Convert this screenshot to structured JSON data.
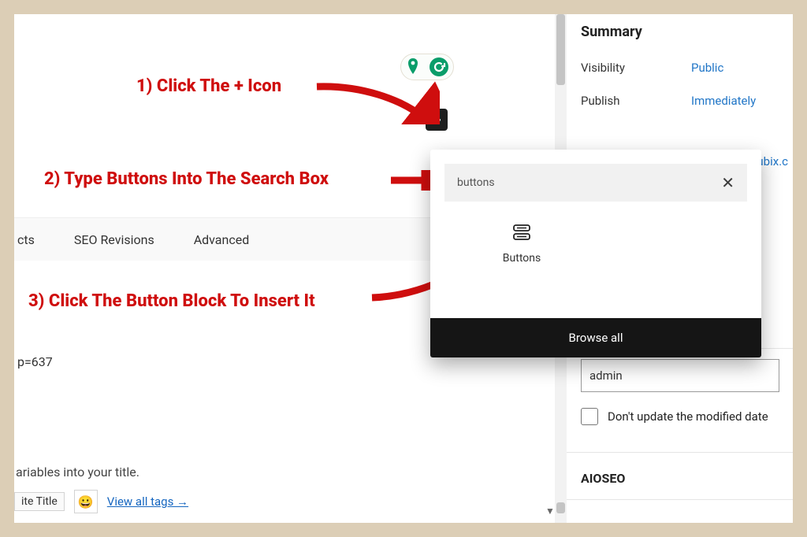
{
  "annotations": {
    "step1": "1) Click The + Icon",
    "step2": "2) Type Buttons Into The Search Box",
    "step3": "3) Click The Button Block To Insert It"
  },
  "toolbar": {
    "plus_label": "+"
  },
  "floating_toggle": {
    "icon1": "marker-icon",
    "icon2": "g-circle-icon",
    "accent": "#0a9d6a"
  },
  "inserter": {
    "search_value": "buttons",
    "clear_glyph": "✕",
    "block_result_label": "Buttons",
    "browse_all_label": "Browse all"
  },
  "tabs": {
    "partial0": "cts",
    "item1": "SEO Revisions",
    "item2": "Advanced"
  },
  "permalink_fragment": "p=637",
  "variables_hint": "ariables into your title.",
  "chips": {
    "site_title_partial": "ite Title",
    "emoji": "😀",
    "view_all_tags": "View all tags →"
  },
  "sidebar": {
    "summary_heading": "Summary",
    "rows": [
      {
        "label": "Visibility",
        "value": "Public"
      },
      {
        "label": "Publish",
        "value": "Immediately"
      }
    ],
    "site_hint_fragment": "erubix.c",
    "author_value": "admin",
    "dont_update_label": "Don't update the modified date",
    "aioseo_heading": "AIOSEO"
  }
}
